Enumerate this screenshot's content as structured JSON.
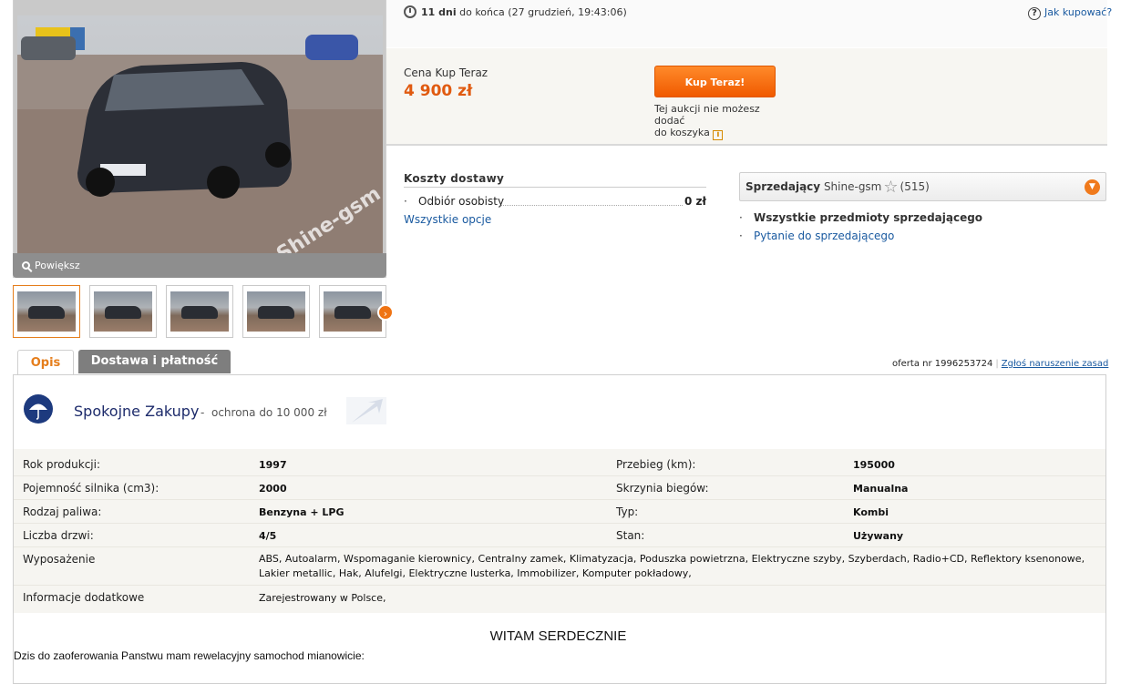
{
  "gallery": {
    "watermark": "Shine-gsm",
    "zoom_label": "Powiększ",
    "thumbnail_count": 5
  },
  "auction": {
    "time_left_bold": "11 dni",
    "time_left_rest": "do końca (27 grudzień, 19:43:06)",
    "how_to_buy": "Jak kupować?"
  },
  "buy": {
    "price_label": "Cena Kup Teraz",
    "price": "4 900 zł",
    "button": "Kup Teraz!",
    "cart_note_line1": "Tej aukcji nie możesz dodać",
    "cart_note_line2": "do koszyka"
  },
  "shipping": {
    "title": "Koszty dostawy",
    "option": "Odbiór osobisty",
    "option_price": "0 zł",
    "all_options": "Wszystkie opcje"
  },
  "seller": {
    "label": "Sprzedający",
    "name": "Shine-gsm",
    "rating": "(515)",
    "all_items": "Wszystkie przedmioty sprzedającego",
    "ask": "Pytanie do sprzedającego"
  },
  "tabs": {
    "description": "Opis",
    "delivery": "Dostawa i płatność"
  },
  "offer": {
    "number": "oferta nr 1996253724",
    "report": "Zgłoś naruszenie zasad"
  },
  "safe": {
    "title": "Spokojne Zakupy",
    "dash": "-",
    "subtitle": "ochrona do 10 000 zł"
  },
  "params": {
    "rows": [
      {
        "l1": "Rok produkcji:",
        "v1": "1997",
        "l2": "Przebieg (km):",
        "v2": "195000"
      },
      {
        "l1": "Pojemność silnika (cm3):",
        "v1": "2000",
        "l2": "Skrzynia biegów:",
        "v2": "Manualna"
      },
      {
        "l1": "Rodzaj paliwa:",
        "v1": "Benzyna + LPG",
        "l2": "Typ:",
        "v2": "Kombi"
      },
      {
        "l1": "Liczba drzwi:",
        "v1": "4/5",
        "l2": "Stan:",
        "v2": "Używany"
      }
    ],
    "equipment_label": "Wyposażenie",
    "equipment_value": "ABS, Autoalarm, Wspomaganie kierownicy, Centralny zamek, Klimatyzacja, Poduszka powietrzna, Elektryczne szyby, Szyberdach, Radio+CD, Reflektory ksenonowe, Lakier metallic, Hak, Alufelgi, Elektryczne lusterka, Immobilizer, Komputer pokładowy,",
    "extra_label": "Informacje dodatkowe",
    "extra_value": "Zarejestrowany w Polsce,"
  },
  "description": {
    "greeting": "WITAM SERDECZNIE",
    "intro": "Dzis do zaoferowania Panstwu mam rewelacyjny samochod mianowicie:"
  },
  "colors": {
    "accent_orange": "#f05a00",
    "link_blue": "#1a5aa0",
    "price_orange": "#e05a10"
  }
}
